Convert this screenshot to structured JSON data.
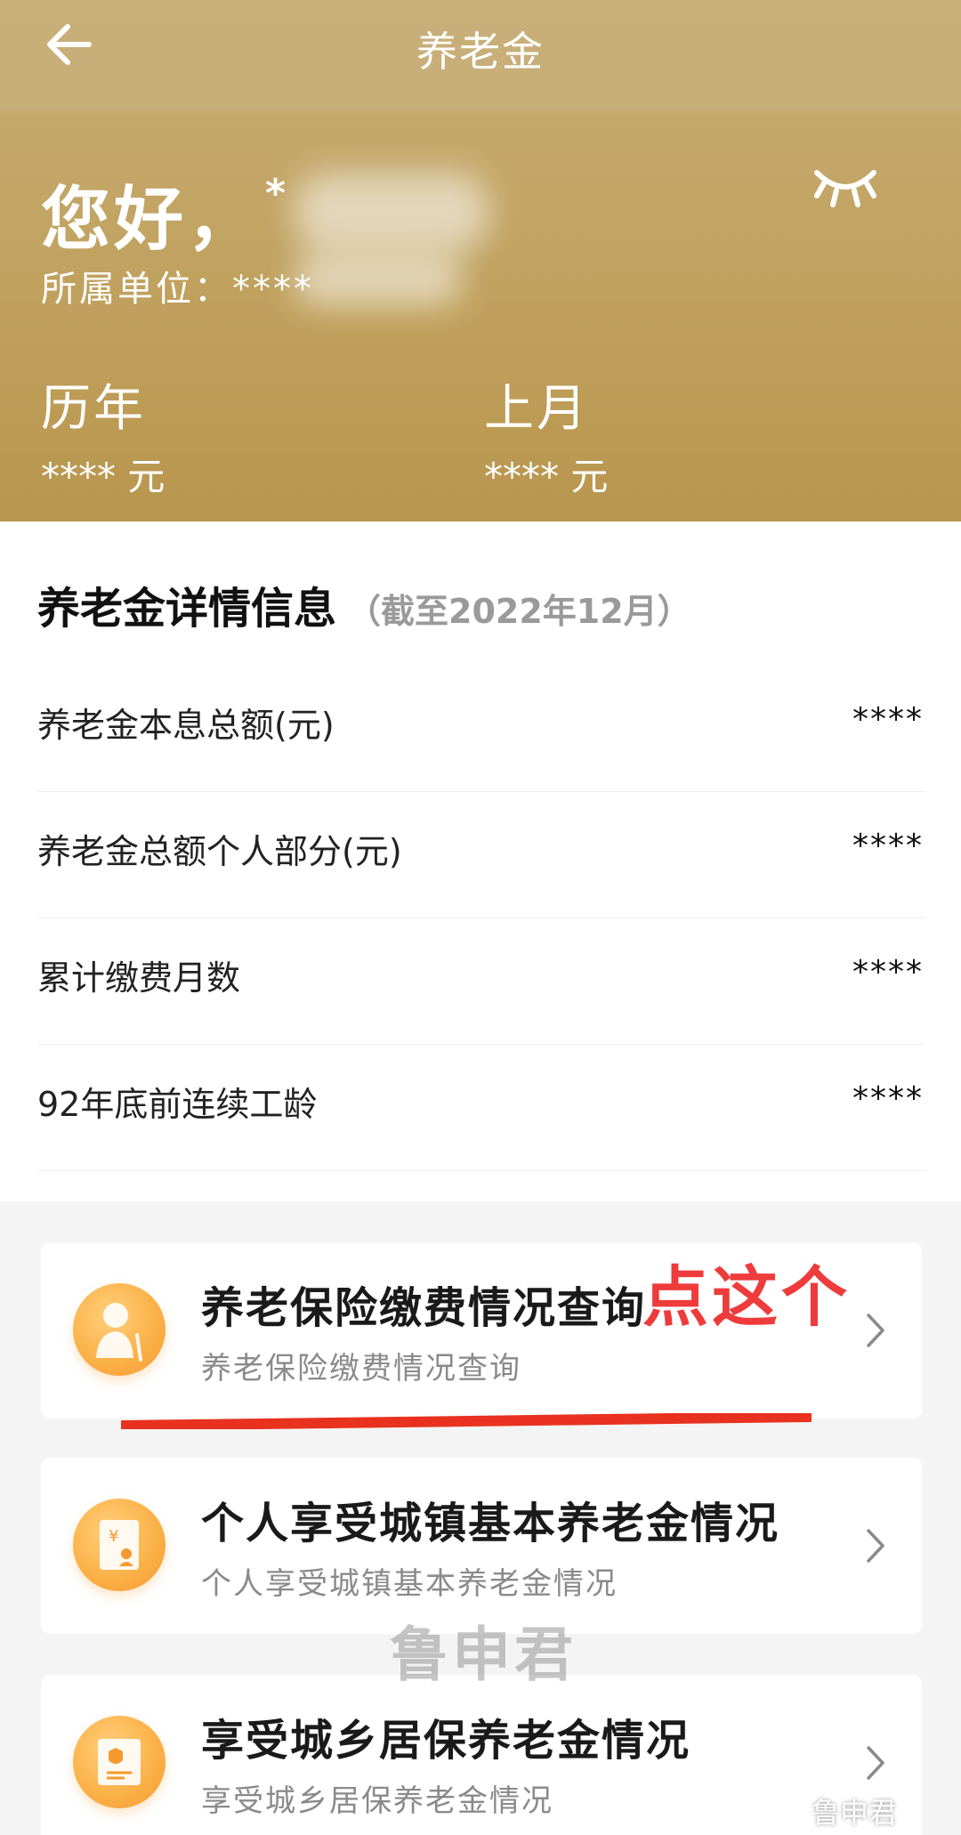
{
  "header": {
    "title": "养老金",
    "back_icon": "back-arrow-icon"
  },
  "profile": {
    "greeting": "您好，",
    "name_masked": "*",
    "unit_label": "所属单位：****",
    "eye_icon": "hide-eye-icon"
  },
  "summary": {
    "yearly_label": "历年",
    "yearly_value": "**** 元",
    "last_month_label": "上月",
    "last_month_value": "**** 元"
  },
  "detail": {
    "title": "养老金详情信息",
    "as_of": "（截至2022年12月）",
    "rows": [
      {
        "label": "养老金本息总额(元)",
        "value": "****"
      },
      {
        "label": "养老金总额个人部分(元)",
        "value": "****"
      },
      {
        "label": "累计缴费月数",
        "value": "****"
      },
      {
        "label": "92年底前连续工龄",
        "value": "****"
      }
    ]
  },
  "cards": [
    {
      "title": "养老保险缴费情况查询",
      "subtitle": "养老保险缴费情况查询",
      "icon": "elderly-person-icon"
    },
    {
      "title": "个人享受城镇基本养老金情况",
      "subtitle": "个人享受城镇基本养老金情况",
      "icon": "yuan-document-icon"
    },
    {
      "title": "享受城乡居保养老金情况",
      "subtitle": "享受城乡居保养老金情况",
      "icon": "shield-document-icon"
    }
  ],
  "annotation": {
    "text": "点这个",
    "color": "#ee3b3b"
  },
  "watermark": "鲁申君",
  "corner_watermark": "鲁申君",
  "colors": {
    "gold": "#c5a96d",
    "orange_icon": "#fbb24a"
  }
}
